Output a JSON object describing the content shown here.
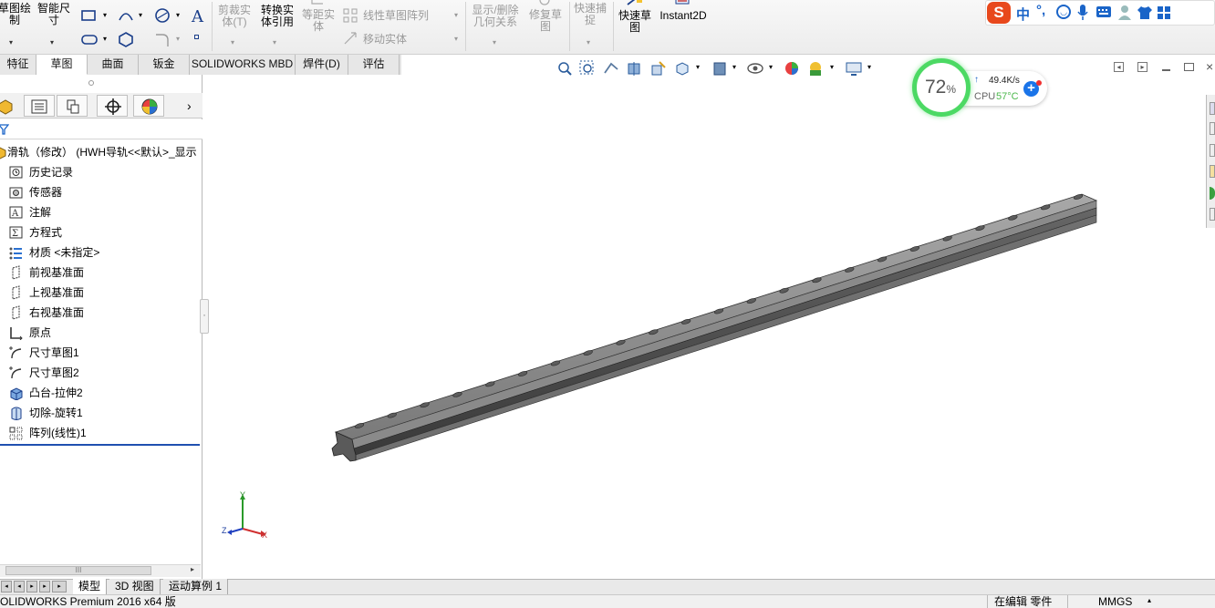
{
  "ribbon": {
    "sketch_draw": "草图绘\n制",
    "smart_dim": "智能尺\n寸",
    "trim": "剪裁实\n体(T)",
    "convert": "转换实\n体引用",
    "offset": "等距实\n体",
    "linear_pattern": "线性草图阵列",
    "move_entities": "移动实体",
    "show_delete": "显示/删除\n几何关系",
    "repair": "修复草\n图",
    "quick_snap": "快速捕\n捉",
    "rapid_sketch": "快速草\n图",
    "instant2d": "Instant2D"
  },
  "tabs": [
    "特征",
    "草图",
    "曲面",
    "钣金",
    "SOLIDWORKS MBD",
    "焊件(D)",
    "评估"
  ],
  "active_tab": 1,
  "tree": {
    "root": "滑轨（修改） (HWH导轨<<默认>_显示",
    "items": [
      {
        "label": "历史记录",
        "icon": "history-icon"
      },
      {
        "label": "传感器",
        "icon": "sensor-icon"
      },
      {
        "label": "注解",
        "icon": "annotation-icon"
      },
      {
        "label": "方程式",
        "icon": "equation-icon"
      },
      {
        "label": "材质 <未指定>",
        "icon": "material-icon"
      },
      {
        "label": "前视基准面",
        "icon": "plane-icon"
      },
      {
        "label": "上视基准面",
        "icon": "plane-icon"
      },
      {
        "label": "右视基准面",
        "icon": "plane-icon"
      },
      {
        "label": "原点",
        "icon": "origin-icon"
      },
      {
        "label": "尺寸草图1",
        "icon": "sketch-icon"
      },
      {
        "label": "尺寸草图2",
        "icon": "sketch-icon"
      },
      {
        "label": "凸台-拉伸2",
        "icon": "extrude-icon"
      },
      {
        "label": "切除-旋转1",
        "icon": "revolve-cut-icon"
      },
      {
        "label": "阵列(线性)1",
        "icon": "pattern-icon"
      }
    ]
  },
  "bottom_tabs": [
    "模型",
    "3D 视图",
    "运动算例 1"
  ],
  "status": {
    "left": "SOLIDWORKS Premium 2016 x64 版",
    "editing": "在编辑 零件",
    "units": "MMGS"
  },
  "widget": {
    "percent": "72",
    "percent_sign": "%",
    "net_speed": "49.4K/s",
    "cpu_label": "CPU",
    "cpu_temp": "57°C"
  },
  "ime": {
    "lang": "中"
  },
  "triad": {
    "x": "X",
    "y": "Y",
    "z": "Z"
  },
  "colors": {
    "accent": "#1a64c8",
    "gauge": "#4cd964",
    "ime_brand": "#e8481c",
    "cpu_temp": "#4cb84c"
  }
}
